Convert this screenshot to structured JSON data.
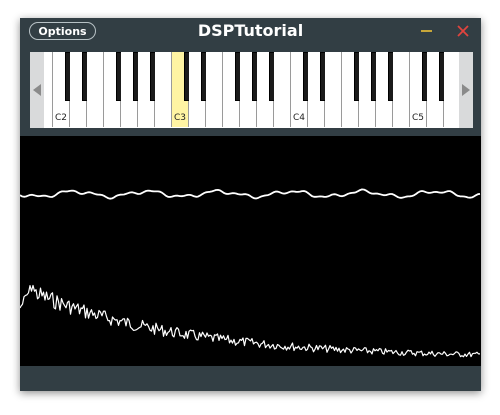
{
  "window": {
    "title": "DSPTutorial"
  },
  "toolbar": {
    "options_label": "Options"
  },
  "keyboard": {
    "octave_labels": [
      "C2",
      "C3",
      "C4",
      "C5"
    ],
    "highlighted_key": "C3"
  },
  "colors": {
    "window_bg": "#323e44",
    "display_bg": "#000000",
    "trace": "#ffffff",
    "key_highlight": "#fff4a3",
    "minimise": "#c7a63a",
    "close": "#e0443e"
  }
}
